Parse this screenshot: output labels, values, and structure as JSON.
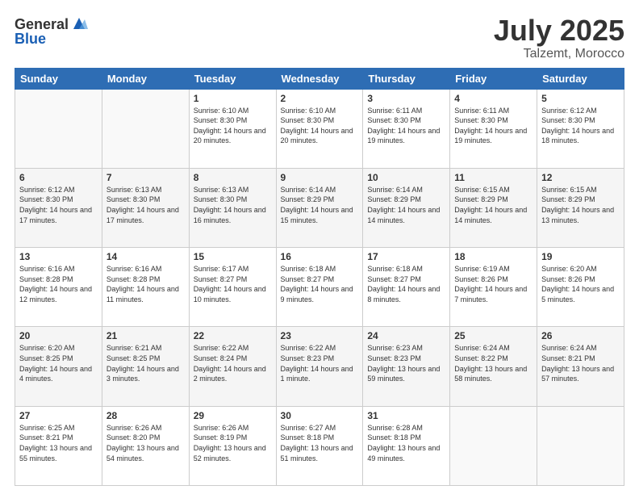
{
  "header": {
    "logo_general": "General",
    "logo_blue": "Blue",
    "month_title": "July 2025",
    "location": "Talzemt, Morocco"
  },
  "days_of_week": [
    "Sunday",
    "Monday",
    "Tuesday",
    "Wednesday",
    "Thursday",
    "Friday",
    "Saturday"
  ],
  "weeks": [
    [
      {
        "num": "",
        "sunrise": "",
        "sunset": "",
        "daylight": ""
      },
      {
        "num": "",
        "sunrise": "",
        "sunset": "",
        "daylight": ""
      },
      {
        "num": "1",
        "sunrise": "Sunrise: 6:10 AM",
        "sunset": "Sunset: 8:30 PM",
        "daylight": "Daylight: 14 hours and 20 minutes."
      },
      {
        "num": "2",
        "sunrise": "Sunrise: 6:10 AM",
        "sunset": "Sunset: 8:30 PM",
        "daylight": "Daylight: 14 hours and 20 minutes."
      },
      {
        "num": "3",
        "sunrise": "Sunrise: 6:11 AM",
        "sunset": "Sunset: 8:30 PM",
        "daylight": "Daylight: 14 hours and 19 minutes."
      },
      {
        "num": "4",
        "sunrise": "Sunrise: 6:11 AM",
        "sunset": "Sunset: 8:30 PM",
        "daylight": "Daylight: 14 hours and 19 minutes."
      },
      {
        "num": "5",
        "sunrise": "Sunrise: 6:12 AM",
        "sunset": "Sunset: 8:30 PM",
        "daylight": "Daylight: 14 hours and 18 minutes."
      }
    ],
    [
      {
        "num": "6",
        "sunrise": "Sunrise: 6:12 AM",
        "sunset": "Sunset: 8:30 PM",
        "daylight": "Daylight: 14 hours and 17 minutes."
      },
      {
        "num": "7",
        "sunrise": "Sunrise: 6:13 AM",
        "sunset": "Sunset: 8:30 PM",
        "daylight": "Daylight: 14 hours and 17 minutes."
      },
      {
        "num": "8",
        "sunrise": "Sunrise: 6:13 AM",
        "sunset": "Sunset: 8:30 PM",
        "daylight": "Daylight: 14 hours and 16 minutes."
      },
      {
        "num": "9",
        "sunrise": "Sunrise: 6:14 AM",
        "sunset": "Sunset: 8:29 PM",
        "daylight": "Daylight: 14 hours and 15 minutes."
      },
      {
        "num": "10",
        "sunrise": "Sunrise: 6:14 AM",
        "sunset": "Sunset: 8:29 PM",
        "daylight": "Daylight: 14 hours and 14 minutes."
      },
      {
        "num": "11",
        "sunrise": "Sunrise: 6:15 AM",
        "sunset": "Sunset: 8:29 PM",
        "daylight": "Daylight: 14 hours and 14 minutes."
      },
      {
        "num": "12",
        "sunrise": "Sunrise: 6:15 AM",
        "sunset": "Sunset: 8:29 PM",
        "daylight": "Daylight: 14 hours and 13 minutes."
      }
    ],
    [
      {
        "num": "13",
        "sunrise": "Sunrise: 6:16 AM",
        "sunset": "Sunset: 8:28 PM",
        "daylight": "Daylight: 14 hours and 12 minutes."
      },
      {
        "num": "14",
        "sunrise": "Sunrise: 6:16 AM",
        "sunset": "Sunset: 8:28 PM",
        "daylight": "Daylight: 14 hours and 11 minutes."
      },
      {
        "num": "15",
        "sunrise": "Sunrise: 6:17 AM",
        "sunset": "Sunset: 8:27 PM",
        "daylight": "Daylight: 14 hours and 10 minutes."
      },
      {
        "num": "16",
        "sunrise": "Sunrise: 6:18 AM",
        "sunset": "Sunset: 8:27 PM",
        "daylight": "Daylight: 14 hours and 9 minutes."
      },
      {
        "num": "17",
        "sunrise": "Sunrise: 6:18 AM",
        "sunset": "Sunset: 8:27 PM",
        "daylight": "Daylight: 14 hours and 8 minutes."
      },
      {
        "num": "18",
        "sunrise": "Sunrise: 6:19 AM",
        "sunset": "Sunset: 8:26 PM",
        "daylight": "Daylight: 14 hours and 7 minutes."
      },
      {
        "num": "19",
        "sunrise": "Sunrise: 6:20 AM",
        "sunset": "Sunset: 8:26 PM",
        "daylight": "Daylight: 14 hours and 5 minutes."
      }
    ],
    [
      {
        "num": "20",
        "sunrise": "Sunrise: 6:20 AM",
        "sunset": "Sunset: 8:25 PM",
        "daylight": "Daylight: 14 hours and 4 minutes."
      },
      {
        "num": "21",
        "sunrise": "Sunrise: 6:21 AM",
        "sunset": "Sunset: 8:25 PM",
        "daylight": "Daylight: 14 hours and 3 minutes."
      },
      {
        "num": "22",
        "sunrise": "Sunrise: 6:22 AM",
        "sunset": "Sunset: 8:24 PM",
        "daylight": "Daylight: 14 hours and 2 minutes."
      },
      {
        "num": "23",
        "sunrise": "Sunrise: 6:22 AM",
        "sunset": "Sunset: 8:23 PM",
        "daylight": "Daylight: 14 hours and 1 minute."
      },
      {
        "num": "24",
        "sunrise": "Sunrise: 6:23 AM",
        "sunset": "Sunset: 8:23 PM",
        "daylight": "Daylight: 13 hours and 59 minutes."
      },
      {
        "num": "25",
        "sunrise": "Sunrise: 6:24 AM",
        "sunset": "Sunset: 8:22 PM",
        "daylight": "Daylight: 13 hours and 58 minutes."
      },
      {
        "num": "26",
        "sunrise": "Sunrise: 6:24 AM",
        "sunset": "Sunset: 8:21 PM",
        "daylight": "Daylight: 13 hours and 57 minutes."
      }
    ],
    [
      {
        "num": "27",
        "sunrise": "Sunrise: 6:25 AM",
        "sunset": "Sunset: 8:21 PM",
        "daylight": "Daylight: 13 hours and 55 minutes."
      },
      {
        "num": "28",
        "sunrise": "Sunrise: 6:26 AM",
        "sunset": "Sunset: 8:20 PM",
        "daylight": "Daylight: 13 hours and 54 minutes."
      },
      {
        "num": "29",
        "sunrise": "Sunrise: 6:26 AM",
        "sunset": "Sunset: 8:19 PM",
        "daylight": "Daylight: 13 hours and 52 minutes."
      },
      {
        "num": "30",
        "sunrise": "Sunrise: 6:27 AM",
        "sunset": "Sunset: 8:18 PM",
        "daylight": "Daylight: 13 hours and 51 minutes."
      },
      {
        "num": "31",
        "sunrise": "Sunrise: 6:28 AM",
        "sunset": "Sunset: 8:18 PM",
        "daylight": "Daylight: 13 hours and 49 minutes."
      },
      {
        "num": "",
        "sunrise": "",
        "sunset": "",
        "daylight": ""
      },
      {
        "num": "",
        "sunrise": "",
        "sunset": "",
        "daylight": ""
      }
    ]
  ]
}
